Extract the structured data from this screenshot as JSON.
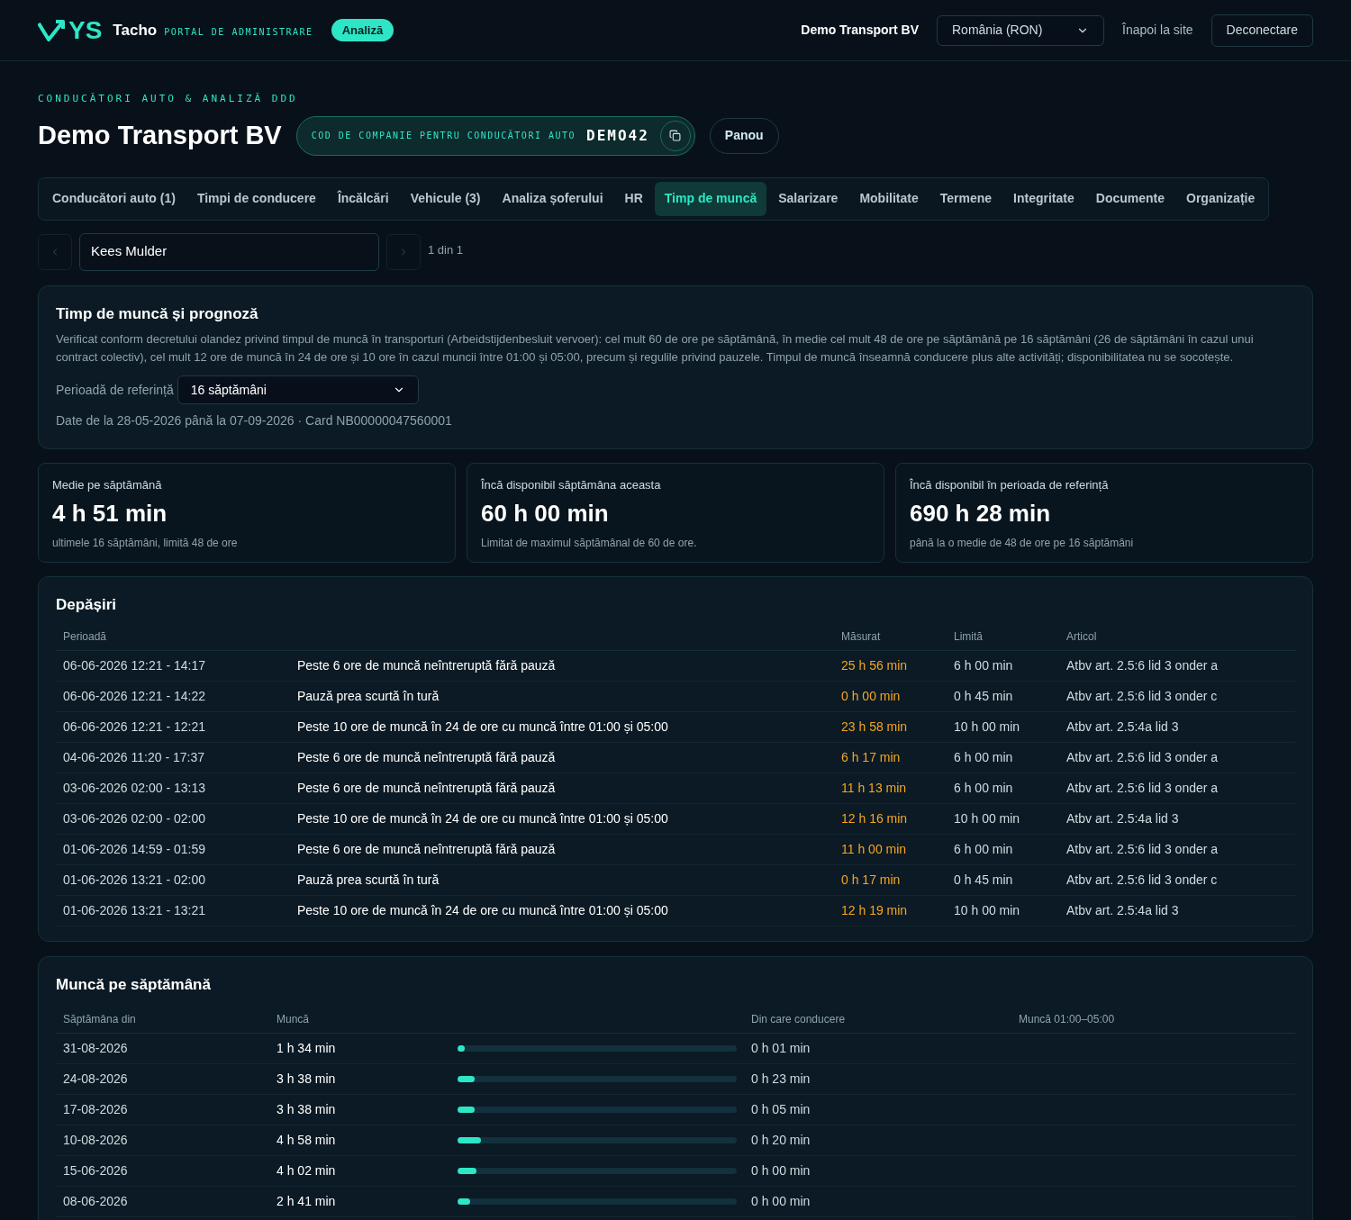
{
  "header": {
    "logo_text": "YS",
    "brand": "Tacho",
    "portal_label": "PORTAL DE ADMINISTRARE",
    "badge": "Analiză",
    "company": "Demo Transport BV",
    "country_select": "România (RON)",
    "back_link": "Înapoi la site",
    "logout_button": "Deconectare"
  },
  "page": {
    "eyebrow": "CONDUCĂTORI AUTO & ANALIZĂ DDD",
    "title": "Demo Transport BV",
    "code_label": "COD DE COMPANIE PENTRU CONDUCĂTORI AUTO",
    "code_value": "DEMO42",
    "panel_button": "Panou"
  },
  "tabs": [
    {
      "label": "Conducători auto (1)",
      "selected": false
    },
    {
      "label": "Timpi de conducere",
      "selected": false
    },
    {
      "label": "Încălcări",
      "selected": false
    },
    {
      "label": "Vehicule (3)",
      "selected": false
    },
    {
      "label": "Analiza șoferului",
      "selected": false
    },
    {
      "label": "HR",
      "selected": false
    },
    {
      "label": "Timp de muncă",
      "selected": true
    },
    {
      "label": "Salarizare",
      "selected": false
    },
    {
      "label": "Mobilitate",
      "selected": false
    },
    {
      "label": "Termene",
      "selected": false
    },
    {
      "label": "Integritate",
      "selected": false
    },
    {
      "label": "Documente",
      "selected": false
    },
    {
      "label": "Organizație",
      "selected": false
    }
  ],
  "driver_picker": {
    "value": "Kees Mulder",
    "prev_disabled": true,
    "next_disabled": true,
    "count": "1 din 1"
  },
  "info_card": {
    "title": "Timp de muncă și prognoză",
    "description": "Verificat conform decretului olandez privind timpul de muncă în transporturi (Arbeidstijdenbesluit vervoer): cel mult 60 de ore pe săptămână, în medie cel mult 48 de ore pe săptămână pe 16 săptămâni (26 de săptămâni în cazul unui contract colectiv), cel mult 12 ore de muncă în 24 de ore și 10 ore în cazul muncii între 01:00 și 05:00, precum și regulile privind pauzele. Timpul de muncă înseamnă conducere plus alte activități; disponibilitatea nu se socotește.",
    "period_label": "Perioadă de referință",
    "period_select": "16 săptămâni",
    "data_range": "Date de la 28-05-2026 până la 07-09-2026 · Card NB00000047560001"
  },
  "stats": [
    {
      "label": "Medie pe săptămână",
      "value": "4 h 51 min",
      "note": "ultimele 16 săptămâni, limită 48 de ore"
    },
    {
      "label": "Încă disponibil săptămâna aceasta",
      "value": "60 h 00 min",
      "note": "Limitat de maximul săptămânal de 60 de ore."
    },
    {
      "label": "Încă disponibil în perioada de referință",
      "value": "690 h 28 min",
      "note": "până la o medie de 48 de ore pe 16 săptămâni"
    }
  ],
  "violations": {
    "title": "Depășiri",
    "columns": [
      "Perioadă",
      "Măsurat",
      "Limită",
      "Articol"
    ],
    "rows": [
      {
        "period": "06-06-2026 12:21 - 14:17",
        "description": "Peste 6 ore de muncă neîntreruptă fără pauză",
        "measured": "25 h 56 min",
        "limit": "6 h 00 min",
        "article": "Atbv art. 2.5:6 lid 3 onder a"
      },
      {
        "period": "06-06-2026 12:21 - 14:22",
        "description": "Pauză prea scurtă în tură",
        "measured": "0 h 00 min",
        "limit": "0 h 45 min",
        "article": "Atbv art. 2.5:6 lid 3 onder c"
      },
      {
        "period": "06-06-2026 12:21 - 12:21",
        "description": "Peste 10 ore de muncă în 24 de ore cu muncă între 01:00 și 05:00",
        "measured": "23 h 58 min",
        "limit": "10 h 00 min",
        "article": "Atbv art. 2.5:4a lid 3"
      },
      {
        "period": "04-06-2026 11:20 - 17:37",
        "description": "Peste 6 ore de muncă neîntreruptă fără pauză",
        "measured": "6 h 17 min",
        "limit": "6 h 00 min",
        "article": "Atbv art. 2.5:6 lid 3 onder a"
      },
      {
        "period": "03-06-2026 02:00 - 13:13",
        "description": "Peste 6 ore de muncă neîntreruptă fără pauză",
        "measured": "11 h 13 min",
        "limit": "6 h 00 min",
        "article": "Atbv art. 2.5:6 lid 3 onder a"
      },
      {
        "period": "03-06-2026 02:00 - 02:00",
        "description": "Peste 10 ore de muncă în 24 de ore cu muncă între 01:00 și 05:00",
        "measured": "12 h 16 min",
        "limit": "10 h 00 min",
        "article": "Atbv art. 2.5:4a lid 3"
      },
      {
        "period": "01-06-2026 14:59 - 01:59",
        "description": "Peste 6 ore de muncă neîntreruptă fără pauză",
        "measured": "11 h 00 min",
        "limit": "6 h 00 min",
        "article": "Atbv art. 2.5:6 lid 3 onder a"
      },
      {
        "period": "01-06-2026 13:21 - 02:00",
        "description": "Pauză prea scurtă în tură",
        "measured": "0 h 17 min",
        "limit": "0 h 45 min",
        "article": "Atbv art. 2.5:6 lid 3 onder c"
      },
      {
        "period": "01-06-2026 13:21 - 13:21",
        "description": "Peste 10 ore de muncă în 24 de ore cu muncă între 01:00 și 05:00",
        "measured": "12 h 19 min",
        "limit": "10 h 00 min",
        "article": "Atbv art. 2.5:4a lid 3"
      }
    ]
  },
  "weekly": {
    "title": "Muncă pe săptămână",
    "columns": [
      "Săptămâna din",
      "Muncă",
      "Din care conducere",
      "Muncă 01:00–05:00"
    ],
    "rows": [
      {
        "week": "31-08-2026",
        "work": "1 h 34 min",
        "level": 0.026,
        "driving": "0 h 01 min"
      },
      {
        "week": "24-08-2026",
        "work": "3 h 38 min",
        "level": 0.061,
        "driving": "0 h 23 min"
      },
      {
        "week": "17-08-2026",
        "work": "3 h 38 min",
        "level": 0.061,
        "driving": "0 h 05 min"
      },
      {
        "week": "10-08-2026",
        "work": "4 h 58 min",
        "level": 0.083,
        "driving": "0 h 20 min"
      },
      {
        "week": "15-06-2026",
        "work": "4 h 02 min",
        "level": 0.067,
        "driving": "0 h 00 min"
      },
      {
        "week": "08-06-2026",
        "work": "2 h 41 min",
        "level": 0.045,
        "driving": "0 h 00 min"
      }
    ]
  }
}
